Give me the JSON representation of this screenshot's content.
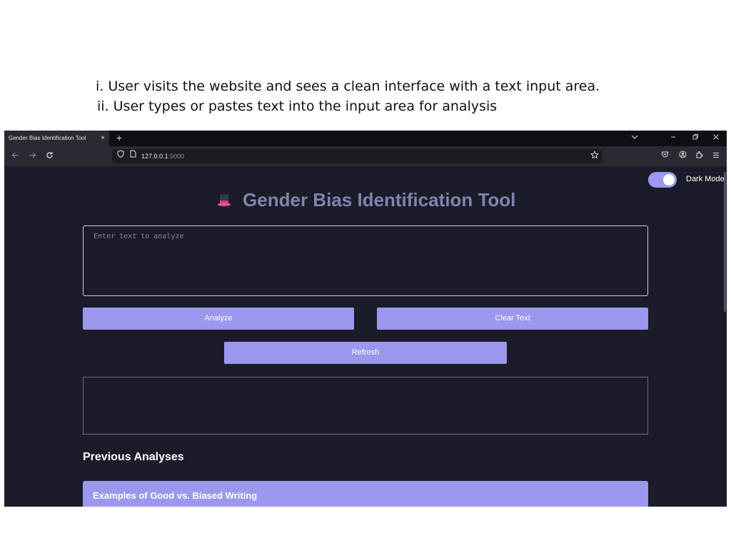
{
  "captions": {
    "step1": "i. User visits the website and sees a clean interface with a text input area.",
    "step2": "ii. User types or pastes text into the input area for analysis"
  },
  "browser": {
    "tab_title": "Gender Bias Identification Tool",
    "tab_close_glyph": "×",
    "new_tab_glyph": "+",
    "url_host": "127.0.0.1",
    "url_port": ":5000",
    "icons": {
      "tab_list": "chevron-down-icon",
      "minimize": "minimize-icon",
      "restore": "restore-icon",
      "close": "close-icon",
      "back": "back-arrow-icon",
      "forward": "forward-arrow-icon",
      "reload": "reload-icon",
      "shield": "shield-icon",
      "page": "page-icon",
      "bookmark": "star-icon",
      "pocket": "pocket-icon",
      "account": "account-icon",
      "extensions": "extensions-icon",
      "menu": "hamburger-menu-icon"
    }
  },
  "app": {
    "dark_mode_label": "Dark Mode",
    "dark_mode_on": true,
    "title": "Gender Bias Identification Tool",
    "title_icon": "top-hat-icon",
    "input_placeholder": "Enter text to analyze",
    "input_value": "",
    "analyze_label": "Analyze",
    "clear_label": "Clear Text",
    "refresh_label": "Refresh",
    "result_text": "",
    "previous_heading": "Previous Analyses",
    "examples_label": "Examples of Good vs. Biased Writing"
  },
  "colors": {
    "accent": "#9b98ee",
    "page_background": "#1c1b29",
    "title_color": "#7d86ad"
  }
}
